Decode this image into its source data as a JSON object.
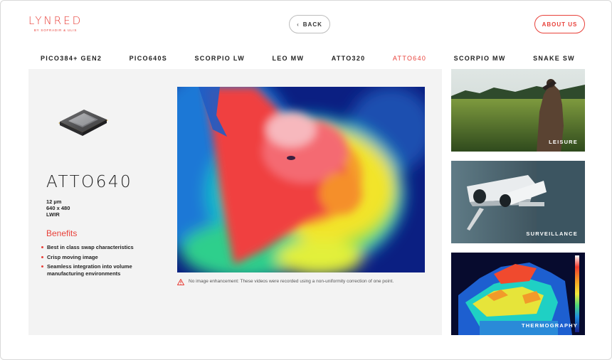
{
  "header": {
    "logo": "LYNRED",
    "logo_subtitle": "BY SOFRADIR & ULIS",
    "back_label": "BACK",
    "about_label": "ABOUT US"
  },
  "nav": {
    "items": [
      "PICO384+ GEN2",
      "PICO640S",
      "SCORPIO LW",
      "LEO MW",
      "ATTO320",
      "ATTO640",
      "SCORPIO MW",
      "SNAKE SW"
    ],
    "active": "ATTO640"
  },
  "product": {
    "title": "ATTO640",
    "specs": [
      "12 µm",
      "640 x 480",
      "LWIR"
    ],
    "benefits_title": "Benefits",
    "benefits": [
      "Best in class swap characteristics",
      "Crisp moving image",
      "Seamless integration into volume manufacturing environments"
    ],
    "note": "No image enhancement: These videos were recorded using a non-uniformity correction of one point."
  },
  "cards": [
    {
      "label": "LEISURE"
    },
    {
      "label": "SURVEILLANCE"
    },
    {
      "label": "THERMOGRAPHY"
    }
  ],
  "colors": {
    "accent": "#e8413a",
    "panel_bg": "#f3f3f3"
  },
  "icons": {
    "back": "chevron-left-icon",
    "warning": "warning-triangle-icon"
  }
}
